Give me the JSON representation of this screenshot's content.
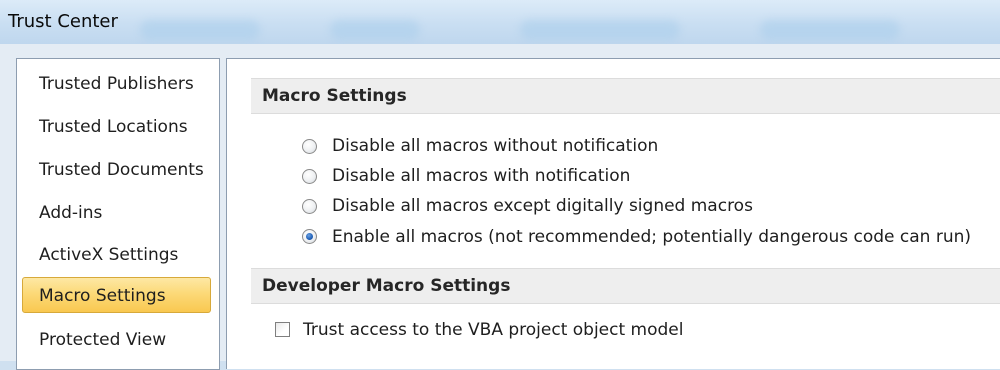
{
  "window": {
    "title": "Trust Center"
  },
  "nav": {
    "items": [
      {
        "label": "Trusted Publishers",
        "selected": false
      },
      {
        "label": "Trusted Locations",
        "selected": false
      },
      {
        "label": "Trusted Documents",
        "selected": false
      },
      {
        "label": "Add-ins",
        "selected": false
      },
      {
        "label": "ActiveX Settings",
        "selected": false
      },
      {
        "label": "Macro Settings",
        "selected": true
      },
      {
        "label": "Protected View",
        "selected": false
      }
    ]
  },
  "macro_settings": {
    "header": "Macro Settings",
    "options": [
      {
        "label": "Disable all macros without notification",
        "checked": false
      },
      {
        "label": "Disable all macros with notification",
        "checked": false
      },
      {
        "label": "Disable all macros except digitally signed macros",
        "checked": false
      },
      {
        "label": "Enable all macros (not recommended; potentially dangerous code can run)",
        "checked": true
      }
    ]
  },
  "developer_macro_settings": {
    "header": "Developer Macro Settings",
    "trust_vba_label": "Trust access to the VBA project object model",
    "trust_vba_checked": false
  },
  "colors": {
    "selected_nav_bg": "#fcd978",
    "selected_nav_border": "#d7a93a",
    "radio_dot": "#1f5fb8",
    "section_header_bg": "#eeeeee"
  }
}
